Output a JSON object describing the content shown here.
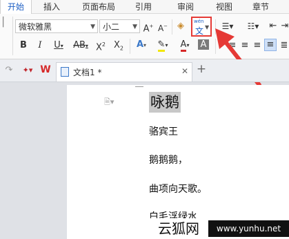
{
  "ribbon_tabs": [
    "开始",
    "插入",
    "页面布局",
    "引用",
    "审阅",
    "视图",
    "章节"
  ],
  "font": {
    "name": "微软雅黑",
    "size": "小二"
  },
  "doc_tab": {
    "title": "文档1 *"
  },
  "document": {
    "title": "咏鹅",
    "lines": [
      "骆宾王",
      "鹅鹅鹅，",
      "曲项向天歌。",
      "白毛浮绿水"
    ]
  },
  "watermark": {
    "logo_text": "云狐网",
    "url": "www.yunhu.net"
  },
  "pinyin_label": {
    "top": "wén",
    "bottom": "文"
  },
  "colors": {
    "accent": "#1d5fc4",
    "highlight_box": "#e53935",
    "arrow": "#e53935",
    "selection": "#c8c8c8"
  }
}
